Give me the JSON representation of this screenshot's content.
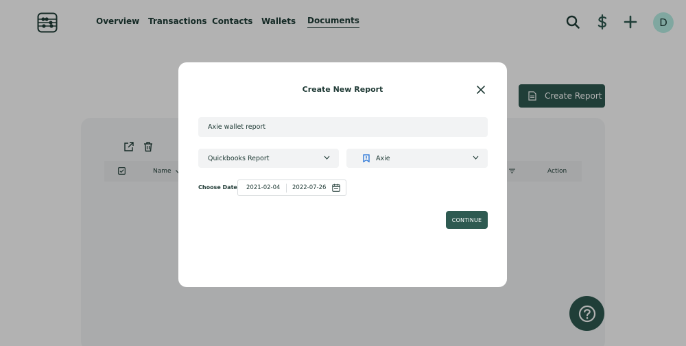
{
  "nav": {
    "items": [
      {
        "label": "Overview",
        "active": false
      },
      {
        "label": "Transactions",
        "active": false
      },
      {
        "label": "Contacts",
        "active": false
      },
      {
        "label": "Wallets",
        "active": false
      },
      {
        "label": "Documents",
        "active": true
      }
    ]
  },
  "header": {
    "avatar_initial": "D",
    "icons": [
      "search-icon",
      "dollar-icon",
      "plus-icon"
    ]
  },
  "page": {
    "create_report_label": "Create Report",
    "table_headers": {
      "name": "Name",
      "action": "Action"
    }
  },
  "modal": {
    "title": "Create New Report",
    "report_name_value": "Axie wallet report",
    "report_type_value": "Quickbooks Report",
    "wallet_value": "Axie",
    "date_label": "Choose Date:",
    "start_date": "2021-02-04",
    "end_date": "2022-07-26",
    "continue_label": "CONTINUE"
  },
  "colors": {
    "primary": "#2e5a51",
    "text": "#203b36",
    "avatar_bg": "#b8f0e6",
    "wallet_icon": "#1f6fd6"
  }
}
